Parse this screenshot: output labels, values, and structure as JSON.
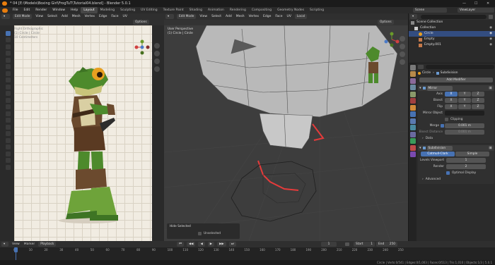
{
  "window": {
    "title": "* 04 [E:\\Models\\Boxing Girl\\FrogTuT\\Tutorial04.blend] - Blender 5.0.1"
  },
  "menu": {
    "items": [
      "File",
      "Edit",
      "Render",
      "Window",
      "Help"
    ],
    "workspaces": [
      "Layout",
      "Modeling",
      "Sculpting",
      "UV Editing",
      "Texture Paint",
      "Shading",
      "Animation",
      "Rendering",
      "Compositing",
      "Geometry Nodes",
      "Scripting"
    ],
    "active_workspace": "Layout",
    "scene": "Scene",
    "view_layer": "ViewLayer"
  },
  "left_viewport": {
    "mode": "Edit Mode",
    "menus": [
      "View",
      "Select",
      "Add",
      "Mesh",
      "Vertex",
      "Edge",
      "Face",
      "UV"
    ],
    "options": "Options",
    "overlay": [
      "Right Orthographic",
      "(1) Circle | Circle",
      "10 Centimeters"
    ]
  },
  "right_viewport": {
    "mode": "Edit Mode",
    "menus": [
      "View",
      "Select",
      "Add",
      "Mesh",
      "Vertex",
      "Edge",
      "Face",
      "UV"
    ],
    "transform": "Local",
    "options": "Options",
    "overlay": [
      "User Perspective",
      "(1) Circle | Circle"
    ],
    "last_op": {
      "title": "Hide Selected",
      "checkbox_label": "Unselected",
      "checkbox_checked": false
    }
  },
  "outliner": {
    "search_placeholder": "",
    "items": [
      {
        "label": "Scene Collection",
        "indent": 0,
        "selected": false
      },
      {
        "label": "Collection",
        "indent": 1,
        "selected": false
      },
      {
        "label": "Circle",
        "indent": 2,
        "selected": true
      },
      {
        "label": "Empty",
        "indent": 2,
        "selected": false
      },
      {
        "label": "Empty.001",
        "indent": 2,
        "selected": false
      }
    ]
  },
  "properties": {
    "breadcrumb_obj": "Circle",
    "breadcrumb_mod": "Subdivision",
    "add_modifier": "Add Modifier",
    "mirror": {
      "name": "Mirror",
      "axis_label": "Axis",
      "bisect_label": "Bisect",
      "flip_label": "Flip",
      "axes": [
        "X",
        "Y",
        "Z"
      ],
      "mirror_object_label": "Mirror Object",
      "clipping_label": "Clipping",
      "merge_label": "Merge",
      "merge_value": "0.001 m",
      "bisect_distance_label": "Bisect Distance",
      "bisect_distance_value": "0.001 m",
      "data_label": "Data"
    },
    "subdivision": {
      "name": "Subdivision",
      "mode_a": "Catmull-Clark",
      "mode_b": "Simple",
      "levels_viewport_label": "Levels Viewport",
      "levels_viewport_value": "1",
      "render_label": "Render",
      "render_value": "2",
      "optimal_label": "Optimal Display",
      "advanced_label": "Advanced"
    }
  },
  "timeline": {
    "menus": [
      "View",
      "Marker",
      "Playback"
    ],
    "current_frame": "1",
    "start_label": "Start",
    "start_value": "1",
    "end_label": "End",
    "end_value": "250",
    "ticks": [
      "0",
      "10",
      "20",
      "30",
      "40",
      "50",
      "60",
      "70",
      "80",
      "90",
      "100",
      "110",
      "120",
      "130",
      "140",
      "150",
      "160",
      "170",
      "180",
      "190",
      "200",
      "210",
      "220",
      "230",
      "240",
      "250"
    ]
  },
  "status": {
    "text": "Circle | Verts:0/541 | Edges:0/1,003 | Faces:0/513 | Tris:1,010 | Objects:1/3 | 5.0.1"
  }
}
